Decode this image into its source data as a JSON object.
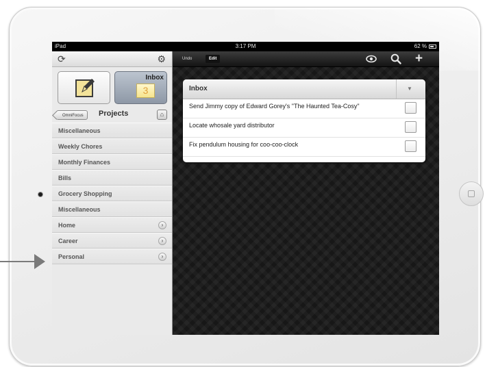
{
  "status_bar": {
    "device": "iPad",
    "time": "3:17 PM",
    "battery": "62 %"
  },
  "sidebar": {
    "inbox_tile": {
      "label": "Inbox",
      "count": "3"
    },
    "back_button": "OmniFocus",
    "title": "Projects",
    "projects": [
      {
        "label": "Miscellaneous",
        "has_disclosure": false
      },
      {
        "label": "Weekly Chores",
        "has_disclosure": false
      },
      {
        "label": "Monthly Finances",
        "has_disclosure": false
      },
      {
        "label": "Bills",
        "has_disclosure": false
      },
      {
        "label": "Grocery Shopping",
        "has_disclosure": false
      },
      {
        "label": "Miscellaneous",
        "has_disclosure": false
      },
      {
        "label": "Home",
        "has_disclosure": true
      },
      {
        "label": "Career",
        "has_disclosure": true
      },
      {
        "label": "Personal",
        "has_disclosure": true
      }
    ]
  },
  "toolbar": {
    "undo_label": "Undo",
    "edit_label": "Edit"
  },
  "inbox_card": {
    "title": "Inbox",
    "tasks": [
      {
        "text": "Send Jimmy copy of Edward Gorey's \"The Haunted Tea-Cosy\""
      },
      {
        "text": "Locate whosale yard distributor"
      },
      {
        "text": "Fix pendulum housing for coo-coo-clock"
      }
    ]
  },
  "icons": {
    "sync": "sync-icon",
    "settings": "gear-icon",
    "new_action": "pencil-icon",
    "home": "home-icon",
    "disclosure": "chevron-right-icon",
    "focus": "eye-icon",
    "search": "search-icon",
    "add": "plus-icon",
    "filter": "triangle-down-icon",
    "annotation": "arrow-right-icon"
  }
}
